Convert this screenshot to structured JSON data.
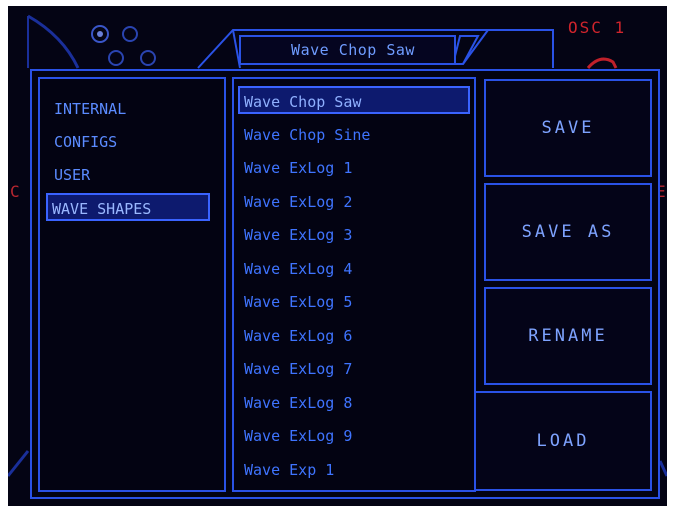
{
  "header": {
    "preset_name": "Wave Chop Saw",
    "osc_label": "OSC 1"
  },
  "side_glyphs": {
    "left": "C",
    "right": "E"
  },
  "categories": [
    {
      "label": "INTERNAL",
      "selected": false
    },
    {
      "label": "CONFIGS",
      "selected": false
    },
    {
      "label": "USER",
      "selected": false
    },
    {
      "label": "WAVE SHAPES",
      "selected": true
    }
  ],
  "presets": [
    {
      "label": "Wave Chop Saw",
      "selected": true
    },
    {
      "label": "Wave Chop Sine",
      "selected": false
    },
    {
      "label": "Wave ExLog 1",
      "selected": false
    },
    {
      "label": "Wave ExLog 2",
      "selected": false
    },
    {
      "label": "Wave ExLog 3",
      "selected": false
    },
    {
      "label": "Wave ExLog 4",
      "selected": false
    },
    {
      "label": "Wave ExLog 5",
      "selected": false
    },
    {
      "label": "Wave ExLog 6",
      "selected": false
    },
    {
      "label": "Wave ExLog 7",
      "selected": false
    },
    {
      "label": "Wave ExLog 8",
      "selected": false
    },
    {
      "label": "Wave ExLog 9",
      "selected": false
    },
    {
      "label": "Wave Exp 1",
      "selected": false
    }
  ],
  "actions": {
    "save": "SAVE",
    "save_as": "SAVE AS",
    "rename": "RENAME",
    "load": "LOAD"
  },
  "colors": {
    "accent": "#2a52e6",
    "text": "#3f74ff",
    "background": "#040414",
    "osc_red": "#d0242c"
  }
}
